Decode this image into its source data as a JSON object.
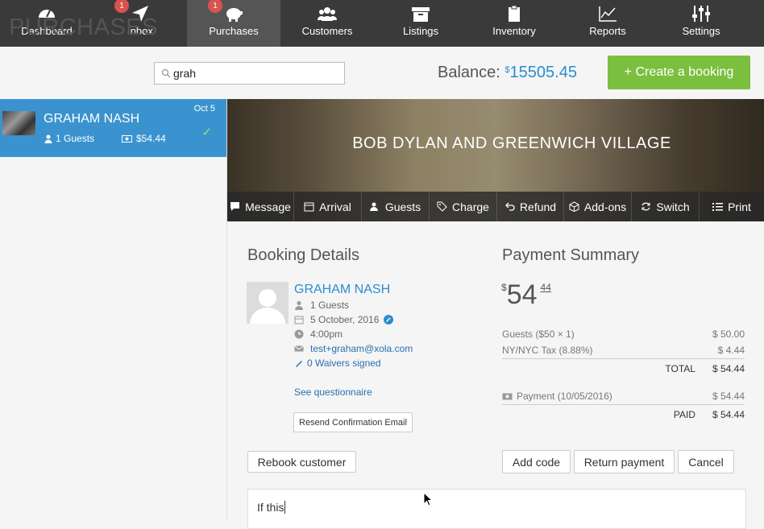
{
  "nav": {
    "items": [
      {
        "label": "Dashboard",
        "icon": "dashboard-icon"
      },
      {
        "label": "Inbox",
        "icon": "send-icon",
        "badge": "1"
      },
      {
        "label": "Purchases",
        "icon": "piggy-bank-icon",
        "badge": "1",
        "active": true
      },
      {
        "label": "Customers",
        "icon": "users-icon"
      },
      {
        "label": "Listings",
        "icon": "archive-icon"
      },
      {
        "label": "Inventory",
        "icon": "clipboard-icon"
      },
      {
        "label": "Reports",
        "icon": "line-chart-icon"
      },
      {
        "label": "Settings",
        "icon": "sliders-icon"
      }
    ]
  },
  "header": {
    "title": "PURCHASES",
    "search_value": "grah",
    "balance_label": "Balance:",
    "balance_currency": "$",
    "balance_amount": "15505.45",
    "create_label": "+ Create a booking"
  },
  "sidebar": {
    "item": {
      "name": "GRAHAM NASH",
      "date": "Oct 5",
      "guests": "1 Guests",
      "price": "$54.44"
    }
  },
  "banner": {
    "title": "BOB DYLAN AND GREENWICH VILLAGE",
    "actions": [
      "Message",
      "Arrival",
      "Guests",
      "Charge",
      "Refund",
      "Add-ons",
      "Switch",
      "Print"
    ]
  },
  "booking": {
    "heading": "Booking Details",
    "name": "GRAHAM NASH",
    "guests": "1 Guests",
    "date": "5 October, 2016",
    "time": "4:00pm",
    "email": "test+graham@xola.com",
    "waivers": "0 Waivers signed",
    "questionnaire": "See questionnaire",
    "resend": "Resend Confirmation Email",
    "rebook": "Rebook customer"
  },
  "payment": {
    "heading": "Payment Summary",
    "currency": "$",
    "dollars": "54",
    "cents": "44",
    "lines": [
      {
        "label": "Guests ($50 × 1)",
        "amount": "$ 50.00"
      },
      {
        "label": "NY/NYC Tax (8.88%)",
        "amount": "$ 4.44"
      }
    ],
    "total_label": "TOTAL",
    "total_amount": "$ 54.44",
    "payment_label": "Payment (10/05/2016)",
    "payment_amount": "$ 54.44",
    "paid_label": "PAID",
    "paid_amount": "$ 54.44",
    "add_code": "Add code",
    "return_payment": "Return payment",
    "cancel": "Cancel"
  },
  "note": {
    "value": "If this "
  },
  "colors": {
    "accent": "#3a93cf",
    "success": "#7bbf3f",
    "nav_bg": "#3a3a3a",
    "link": "#2a8dd0"
  }
}
